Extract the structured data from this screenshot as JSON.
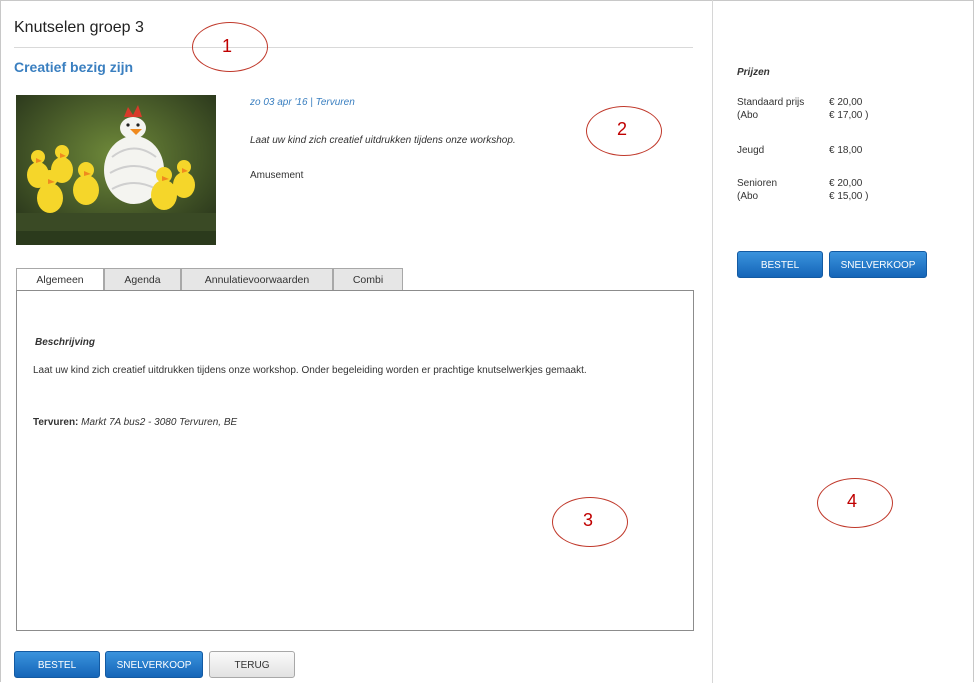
{
  "event": {
    "title": "Knutselen groep 3",
    "subtitle": "Creatief bezig zijn",
    "date_location": "zo 03 apr '16 | Tervuren",
    "teaser": "Laat uw kind zich creatief uitdrukken tijdens onze workshop.",
    "genre": "Amusement"
  },
  "tabs": [
    {
      "label": "Algemeen"
    },
    {
      "label": "Agenda"
    },
    {
      "label": "Annulatievoorwaarden"
    },
    {
      "label": "Combi"
    }
  ],
  "description": {
    "heading": "Beschrijving",
    "text": "Laat uw kind zich creatief uitdrukken tijdens onze workshop.  Onder begeleiding worden er prachtige knutselwerkjes gemaakt.",
    "location_label": "Tervuren:",
    "location_address": "Markt 7A bus2 - 3080 Tervuren, BE"
  },
  "actions": {
    "bestel": "BESTEL",
    "snelverkoop": "SNELVERKOOP",
    "terug": "TERUG"
  },
  "prices": {
    "heading": "Prijzen",
    "rows": [
      {
        "label": "Standaard prijs",
        "value": "€ 20,00"
      },
      {
        "label": "(Abo",
        "value": "€ 17,00 )"
      },
      {
        "label": "Jeugd",
        "value": "€ 18,00"
      },
      {
        "label": "Senioren",
        "value": "€ 20,00"
      },
      {
        "label": "(Abo",
        "value": "€ 15,00 )"
      }
    ]
  },
  "annotations": [
    "1",
    "2",
    "3",
    "4"
  ],
  "colors": {
    "accent_blue": "#3a7fc0",
    "button_blue": "#1a76c9",
    "annotation_red": "#c00000"
  }
}
